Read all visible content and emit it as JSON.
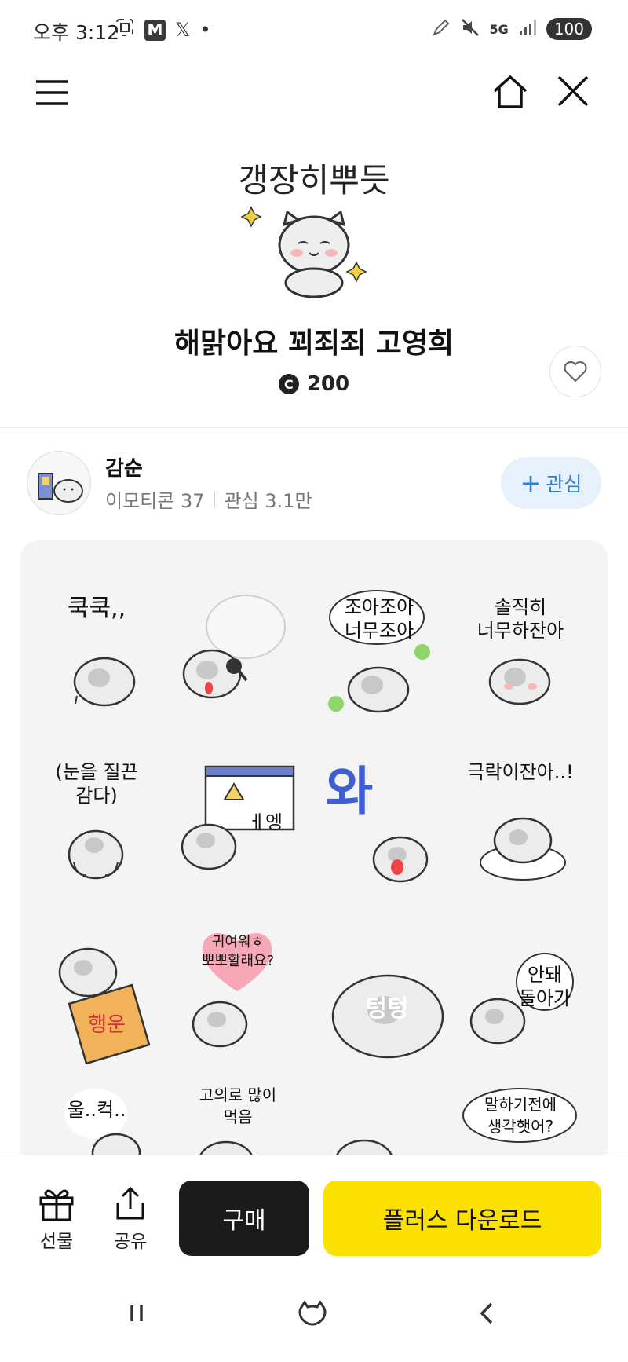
{
  "status_bar": {
    "time": "오후 3:12",
    "battery": "100",
    "network": "5G",
    "icons": [
      "screenshot-icon",
      "m-app-icon",
      "x-app-icon",
      "dot-icon",
      "pen-icon",
      "mute-icon",
      "network-5g-icon",
      "signal-icon",
      "battery-icon"
    ],
    "m_label": "M",
    "x_label": "𝕏"
  },
  "nav": {
    "icons": [
      "menu-icon",
      "home-icon",
      "close-icon"
    ]
  },
  "product": {
    "preview_caption": "갱장히뿌듯",
    "title": "해맑아요 꾀죄죄 고영희",
    "coin_symbol": "C",
    "price": "200"
  },
  "creator": {
    "name": "감순",
    "emoticon_count": "이모티콘 37",
    "followers": "관심 3.1만",
    "follow_plus": "+",
    "follow_label": "관심"
  },
  "stickers": [
    {
      "text": "쿡쿡,,"
    },
    {
      "text": ""
    },
    {
      "text": "조아조아\n너무조아"
    },
    {
      "text": "솔직히\n너무하잔아"
    },
    {
      "text": "(눈을 질끈\n감다)"
    },
    {
      "text": "ㅔ엥"
    },
    {
      "text": "와"
    },
    {
      "text": "극락이잔아..!"
    },
    {
      "text": "행운"
    },
    {
      "text": "귀여워ㅎ\n뽀뽀할래요?"
    },
    {
      "text": "텅텅"
    },
    {
      "text": "안돼\n돌아가"
    },
    {
      "text": "울..컥.."
    },
    {
      "text": "고의로 많이\n먹음"
    },
    {
      "text": ""
    },
    {
      "text": "말하기전에\n생각햇어?"
    }
  ],
  "bottom_bar": {
    "gift_label": "선물",
    "share_label": "공유",
    "buy_label": "구매",
    "plus_label": "플러스 다운로드"
  },
  "colors": {
    "accent_yellow": "#fae100",
    "buy_black": "#1b1b1b",
    "follow_blue": "#2f7fd0",
    "follow_bg": "#e6f1fb",
    "grid_bg": "#f4f4f4"
  }
}
